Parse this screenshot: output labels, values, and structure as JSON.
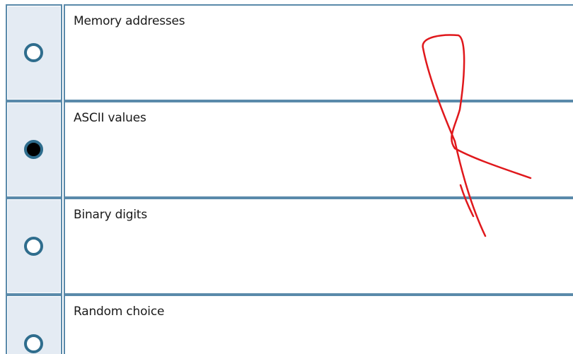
{
  "question": {
    "options": [
      {
        "label": "Memory addresses",
        "selected": false
      },
      {
        "label": "ASCII values",
        "selected": true
      },
      {
        "label": "Binary digits",
        "selected": false
      },
      {
        "label": "Random choice",
        "selected": false
      }
    ]
  },
  "colors": {
    "border": "#5a8aaa",
    "radio_cell_bg": "#e4ebf3",
    "radio_ring": "#2f6d8d",
    "annotation_stroke": "#e0181c"
  },
  "annotation": {
    "type": "handwritten-red-ink-mark"
  }
}
